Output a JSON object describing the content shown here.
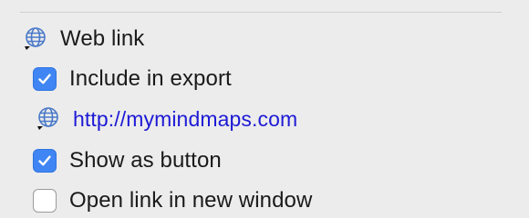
{
  "panel": {
    "heading": "Web link",
    "url": "http://mymindmaps.com",
    "options": [
      {
        "label": "Include in export",
        "checked": true
      },
      {
        "label": "Show as button",
        "checked": true
      },
      {
        "label": "Open link in new window",
        "checked": false
      }
    ]
  },
  "icons": {
    "heading": "globe-link-icon",
    "url": "globe-link-icon"
  },
  "colors": {
    "accent": "#3f86f4",
    "link": "#1d1ad6"
  }
}
